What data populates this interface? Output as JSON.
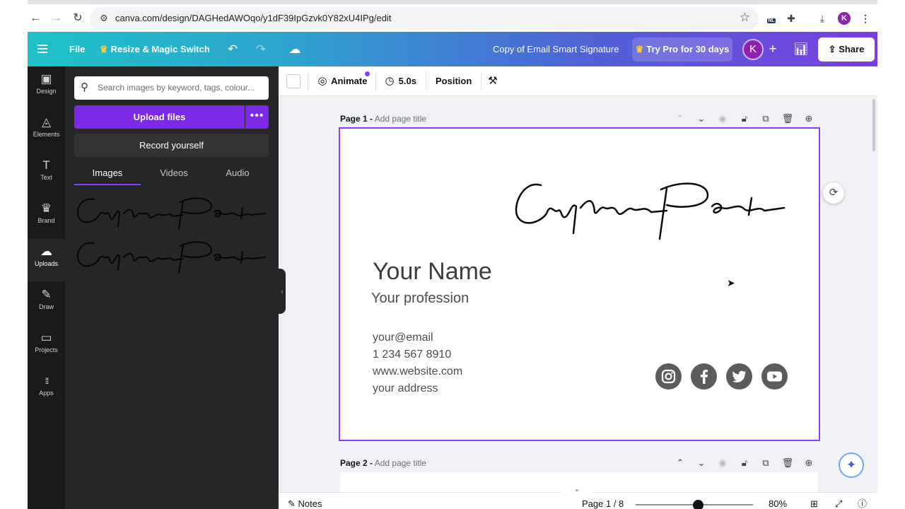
{
  "browser": {
    "url": "canva.com/design/DAGHedAWOqo/y1dF39IpGzvk0Y82xU4IPg/edit",
    "profile_initial": "K",
    "ext_badge": "NL"
  },
  "header": {
    "menu_file": "File",
    "resize_label": "Resize & Magic Switch",
    "doc_title": "Copy of Email Smart Signature",
    "try_pro": "Try Pro for 30 days",
    "avatar_initial": "K",
    "share_label": "Share"
  },
  "rail": {
    "items": [
      {
        "icon": "design-icon",
        "glyph": "▣",
        "label": "Design"
      },
      {
        "icon": "elements-icon",
        "glyph": "◬",
        "label": "Elements"
      },
      {
        "icon": "text-icon",
        "glyph": "T",
        "label": "Text"
      },
      {
        "icon": "brand-icon",
        "glyph": "♛",
        "label": "Brand"
      },
      {
        "icon": "uploads-icon",
        "glyph": "☁",
        "label": "Uploads"
      },
      {
        "icon": "draw-icon",
        "glyph": "✎",
        "label": "Draw"
      },
      {
        "icon": "projects-icon",
        "glyph": "▭",
        "label": "Projects"
      },
      {
        "icon": "apps-icon",
        "glyph": "⁞⁞⁞",
        "label": "Apps"
      }
    ]
  },
  "panel": {
    "search_placeholder": "Search images by keyword, tags, colour...",
    "upload_label": "Upload files",
    "upload_more": "•••",
    "record_label": "Record yourself",
    "tabs": [
      "Images",
      "Videos",
      "Audio"
    ]
  },
  "toolbar": {
    "animate_label": "Animate",
    "duration_label": "5.0s",
    "position_label": "Position"
  },
  "canvas": {
    "page1_label": "Page 1 -",
    "page1_title_placeholder": "Add page title",
    "page2_label": "Page 2 -",
    "page2_title_placeholder": "Add page title",
    "name": "Your Name",
    "profession": "Your profession",
    "contacts": [
      "your@email",
      "1 234 567 8910",
      "www.website.com",
      "your address"
    ],
    "socials": [
      "instagram-icon",
      "facebook-icon",
      "twitter-icon",
      "youtube-icon"
    ]
  },
  "footer": {
    "notes_label": "Notes",
    "page_count": "Page 1 / 8",
    "zoom": "80%",
    "zoom_fraction": 0.53
  },
  "colors": {
    "accent_purple": "#8b3dff",
    "upload_button": "#7d2ae8",
    "panel_bg": "#252627",
    "rail_bg": "#18191b"
  }
}
